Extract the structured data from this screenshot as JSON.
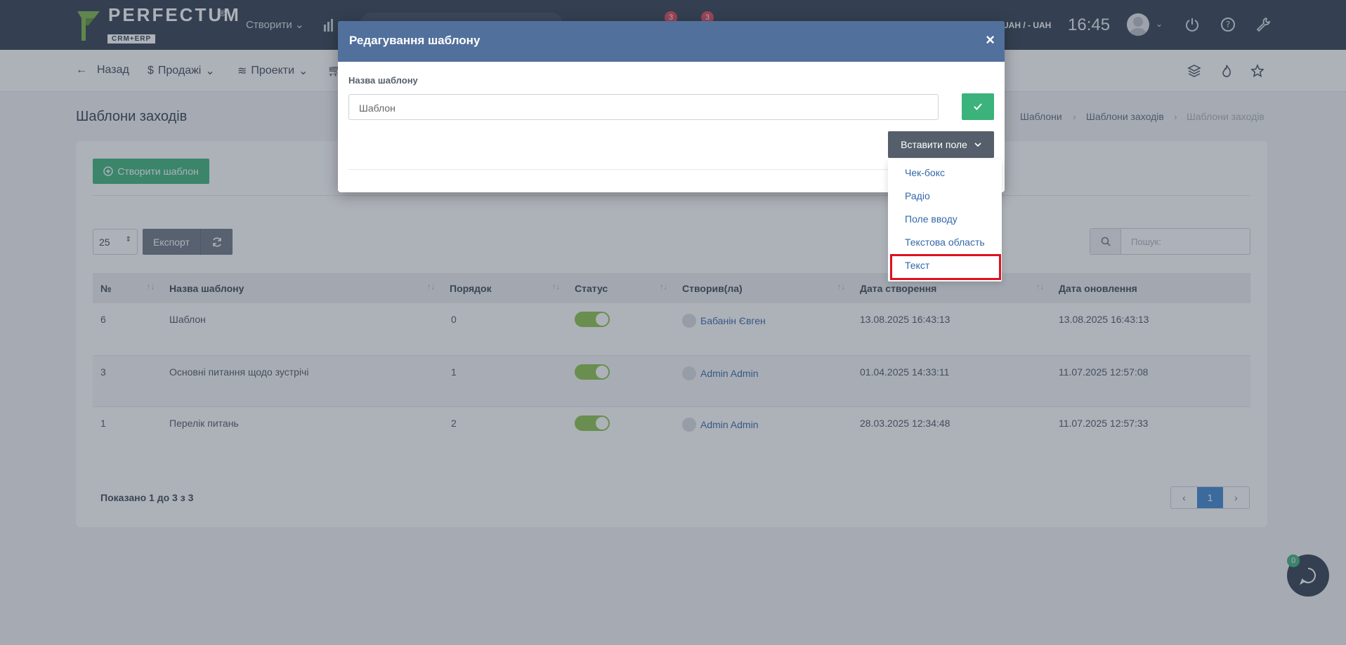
{
  "brand": {
    "name": "PERFECTUM",
    "reg": "®",
    "sub": "CRM+ERP"
  },
  "topbar": {
    "create_menu": "Створити",
    "badge_1": "3",
    "badge_2": "3",
    "currency": "UAH / - UAH",
    "time": "16:45"
  },
  "subnav": {
    "back": "Назад",
    "sales": "Продажі",
    "projects": "Проекти"
  },
  "page": {
    "title": "Шаблони заходів",
    "breadcrumb": [
      "Шаблони",
      "Шаблони заходів",
      "Шаблони заходів"
    ]
  },
  "toolbar": {
    "create_template": "Створити шаблон",
    "page_size": "25",
    "export": "Експорт",
    "search_placeholder": "Пошук:"
  },
  "table": {
    "headers": [
      "№",
      "Назва шаблону",
      "Порядок",
      "Статус",
      "Створив(ла)",
      "Дата створення",
      "Дата оновлення"
    ],
    "rows": [
      {
        "id": "6",
        "name": "Шаблон",
        "order": "0",
        "status": true,
        "creator": "Бабанін Євген",
        "created": "13.08.2025 16:43:13",
        "updated": "13.08.2025 16:43:13"
      },
      {
        "id": "3",
        "name": "Основні питання щодо зустрічі",
        "order": "1",
        "status": true,
        "creator": "Admin Admin",
        "created": "01.04.2025 14:33:11",
        "updated": "11.07.2025 12:57:08"
      },
      {
        "id": "1",
        "name": "Перелік питань",
        "order": "2",
        "status": true,
        "creator": "Admin Admin",
        "created": "28.03.2025 12:34:48",
        "updated": "11.07.2025 12:57:33"
      }
    ]
  },
  "footer": {
    "shown": "Показано 1 до 3 з 3",
    "page": "1"
  },
  "chat": {
    "badge": "0"
  },
  "modal": {
    "title": "Редагування шаблону",
    "close": "×",
    "field_label": "Назва шаблону",
    "field_value": "Шаблон",
    "insert_field": "Вставити поле",
    "dropdown": [
      "Чек-бокс",
      "Радіо",
      "Поле вводу",
      "Текстова область",
      "Текст"
    ]
  },
  "colors": {
    "topbar": "#2f3d4f",
    "modal_header": "#52709c",
    "accent_green": "#3bb37a",
    "highlight": "#e0101e",
    "link": "#3367a8"
  }
}
